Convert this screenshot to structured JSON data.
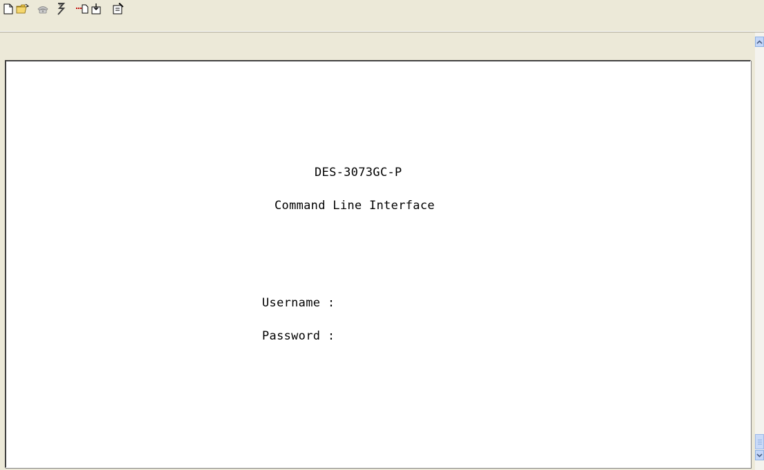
{
  "toolbar": {
    "buttons": [
      {
        "icon": "new-document-icon"
      },
      {
        "icon": "open-folder-icon"
      },
      {
        "icon": "connect-phone-icon"
      },
      {
        "icon": "disconnect-icon"
      },
      {
        "icon": "send-icon"
      },
      {
        "icon": "receive-icon"
      },
      {
        "icon": "properties-icon"
      }
    ]
  },
  "terminal": {
    "device_name": "DES-3073GC-P",
    "subtitle": "Command Line Interface",
    "username_prompt": "Username :",
    "password_prompt": "Password :"
  },
  "scrollbar": {
    "up_icon": "scroll-up-arrow-icon",
    "down_icon": "scroll-down-arrow-icon"
  },
  "colors": {
    "window_bg": "#ece9d8",
    "terminal_bg": "#ffffff",
    "text": "#000000",
    "scroll_accent": "#c3d6f9"
  }
}
